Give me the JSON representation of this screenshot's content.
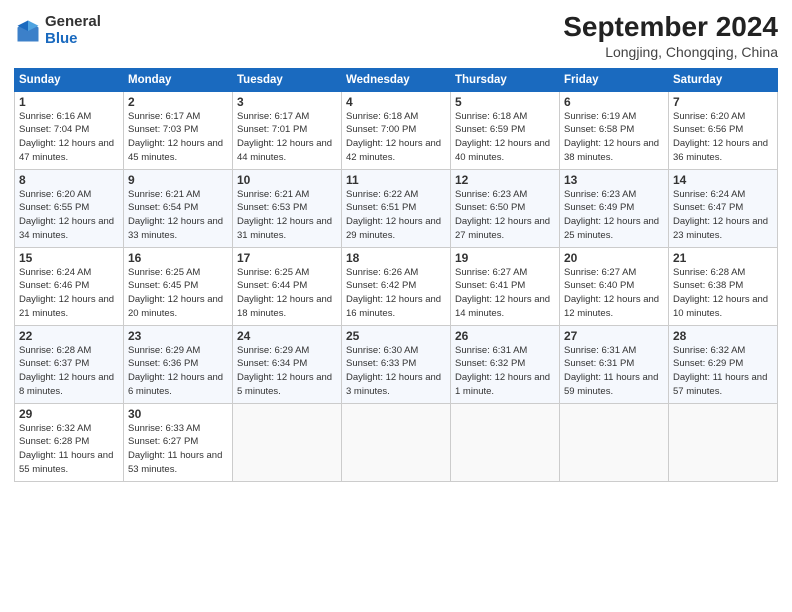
{
  "header": {
    "logo_general": "General",
    "logo_blue": "Blue",
    "month_title": "September 2024",
    "location": "Longjing, Chongqing, China"
  },
  "weekdays": [
    "Sunday",
    "Monday",
    "Tuesday",
    "Wednesday",
    "Thursday",
    "Friday",
    "Saturday"
  ],
  "weeks": [
    [
      {
        "day": "1",
        "info": "Sunrise: 6:16 AM\nSunset: 7:04 PM\nDaylight: 12 hours and 47 minutes."
      },
      {
        "day": "2",
        "info": "Sunrise: 6:17 AM\nSunset: 7:03 PM\nDaylight: 12 hours and 45 minutes."
      },
      {
        "day": "3",
        "info": "Sunrise: 6:17 AM\nSunset: 7:01 PM\nDaylight: 12 hours and 44 minutes."
      },
      {
        "day": "4",
        "info": "Sunrise: 6:18 AM\nSunset: 7:00 PM\nDaylight: 12 hours and 42 minutes."
      },
      {
        "day": "5",
        "info": "Sunrise: 6:18 AM\nSunset: 6:59 PM\nDaylight: 12 hours and 40 minutes."
      },
      {
        "day": "6",
        "info": "Sunrise: 6:19 AM\nSunset: 6:58 PM\nDaylight: 12 hours and 38 minutes."
      },
      {
        "day": "7",
        "info": "Sunrise: 6:20 AM\nSunset: 6:56 PM\nDaylight: 12 hours and 36 minutes."
      }
    ],
    [
      {
        "day": "8",
        "info": "Sunrise: 6:20 AM\nSunset: 6:55 PM\nDaylight: 12 hours and 34 minutes."
      },
      {
        "day": "9",
        "info": "Sunrise: 6:21 AM\nSunset: 6:54 PM\nDaylight: 12 hours and 33 minutes."
      },
      {
        "day": "10",
        "info": "Sunrise: 6:21 AM\nSunset: 6:53 PM\nDaylight: 12 hours and 31 minutes."
      },
      {
        "day": "11",
        "info": "Sunrise: 6:22 AM\nSunset: 6:51 PM\nDaylight: 12 hours and 29 minutes."
      },
      {
        "day": "12",
        "info": "Sunrise: 6:23 AM\nSunset: 6:50 PM\nDaylight: 12 hours and 27 minutes."
      },
      {
        "day": "13",
        "info": "Sunrise: 6:23 AM\nSunset: 6:49 PM\nDaylight: 12 hours and 25 minutes."
      },
      {
        "day": "14",
        "info": "Sunrise: 6:24 AM\nSunset: 6:47 PM\nDaylight: 12 hours and 23 minutes."
      }
    ],
    [
      {
        "day": "15",
        "info": "Sunrise: 6:24 AM\nSunset: 6:46 PM\nDaylight: 12 hours and 21 minutes."
      },
      {
        "day": "16",
        "info": "Sunrise: 6:25 AM\nSunset: 6:45 PM\nDaylight: 12 hours and 20 minutes."
      },
      {
        "day": "17",
        "info": "Sunrise: 6:25 AM\nSunset: 6:44 PM\nDaylight: 12 hours and 18 minutes."
      },
      {
        "day": "18",
        "info": "Sunrise: 6:26 AM\nSunset: 6:42 PM\nDaylight: 12 hours and 16 minutes."
      },
      {
        "day": "19",
        "info": "Sunrise: 6:27 AM\nSunset: 6:41 PM\nDaylight: 12 hours and 14 minutes."
      },
      {
        "day": "20",
        "info": "Sunrise: 6:27 AM\nSunset: 6:40 PM\nDaylight: 12 hours and 12 minutes."
      },
      {
        "day": "21",
        "info": "Sunrise: 6:28 AM\nSunset: 6:38 PM\nDaylight: 12 hours and 10 minutes."
      }
    ],
    [
      {
        "day": "22",
        "info": "Sunrise: 6:28 AM\nSunset: 6:37 PM\nDaylight: 12 hours and 8 minutes."
      },
      {
        "day": "23",
        "info": "Sunrise: 6:29 AM\nSunset: 6:36 PM\nDaylight: 12 hours and 6 minutes."
      },
      {
        "day": "24",
        "info": "Sunrise: 6:29 AM\nSunset: 6:34 PM\nDaylight: 12 hours and 5 minutes."
      },
      {
        "day": "25",
        "info": "Sunrise: 6:30 AM\nSunset: 6:33 PM\nDaylight: 12 hours and 3 minutes."
      },
      {
        "day": "26",
        "info": "Sunrise: 6:31 AM\nSunset: 6:32 PM\nDaylight: 12 hours and 1 minute."
      },
      {
        "day": "27",
        "info": "Sunrise: 6:31 AM\nSunset: 6:31 PM\nDaylight: 11 hours and 59 minutes."
      },
      {
        "day": "28",
        "info": "Sunrise: 6:32 AM\nSunset: 6:29 PM\nDaylight: 11 hours and 57 minutes."
      }
    ],
    [
      {
        "day": "29",
        "info": "Sunrise: 6:32 AM\nSunset: 6:28 PM\nDaylight: 11 hours and 55 minutes."
      },
      {
        "day": "30",
        "info": "Sunrise: 6:33 AM\nSunset: 6:27 PM\nDaylight: 11 hours and 53 minutes."
      },
      {
        "day": "",
        "info": ""
      },
      {
        "day": "",
        "info": ""
      },
      {
        "day": "",
        "info": ""
      },
      {
        "day": "",
        "info": ""
      },
      {
        "day": "",
        "info": ""
      }
    ]
  ]
}
